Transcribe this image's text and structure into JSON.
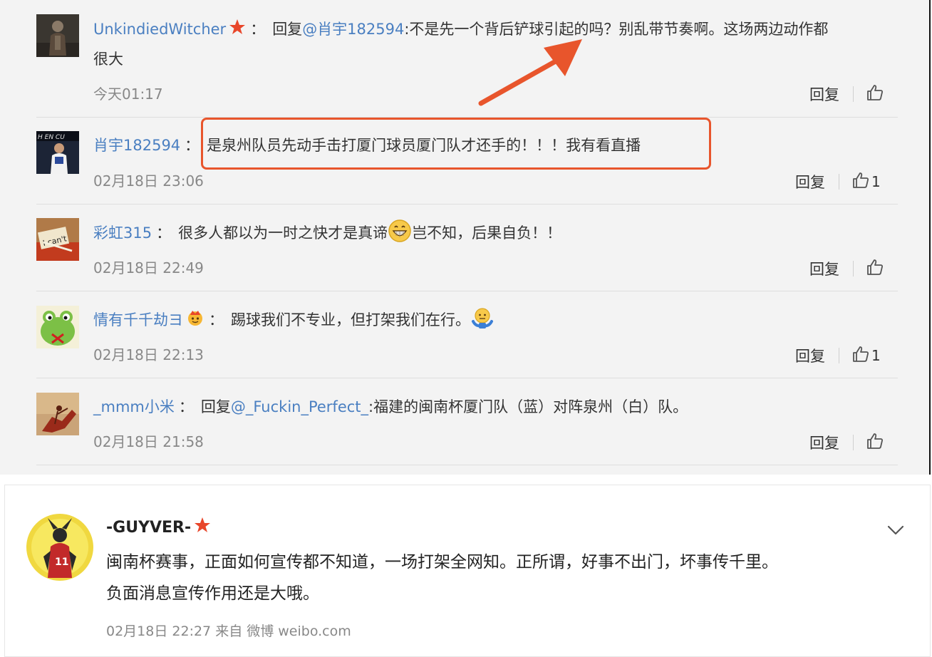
{
  "colors": {
    "link": "#4a7fc1",
    "highlight": "#e8552c",
    "star": "#e8462a",
    "text": "#333333",
    "muted": "#888888"
  },
  "comments": [
    {
      "user": "UnkindiedWitcher",
      "has_star": true,
      "prefix": "回复",
      "mention": "@肖宇182594",
      "text": ":不是先一个背后铲球引起的吗？别乱带节奏啊。这场两边动作都",
      "text2": "很大",
      "time": "今天01:17",
      "reply_label": "回复",
      "likes": ""
    },
    {
      "user": "肖宇182594",
      "text": "是泉州队员先动手击打厦门球员厦门队才还手的！！！我有看直播",
      "time": "02月18日 23:06",
      "reply_label": "回复",
      "likes": "1"
    },
    {
      "user": "彩虹315",
      "text": "很多人都以为一时之快才是真谛",
      "text_after_emoji": "岂不知，后果自负！！",
      "emoji": "grin-emoji",
      "time": "02月18日 22:49",
      "reply_label": "回复",
      "likes": ""
    },
    {
      "user": "情有千千劫ヨ",
      "has_crown": true,
      "text": "踢球我们不专业，但打架我们在行。",
      "emoji": "shrug-emoji",
      "time": "02月18日 22:13",
      "reply_label": "回复",
      "likes": "1"
    },
    {
      "user": "_mmm小米",
      "prefix": "回复",
      "mention": "@_Fuckin_Perfect_",
      "text": ":福建的闽南杯厦门队（蓝）对阵泉州（白）队。",
      "time": "02月18日 21:58",
      "reply_label": "回复",
      "likes": ""
    }
  ],
  "post": {
    "user": "-GUYVER-",
    "line1": "闽南杯赛事，正面如何宣传都不知道，一场打架全网知。正所谓，好事不出门，坏事传千里。",
    "line2": "负面消息宣传作用还是大哦。",
    "meta": "02月18日 22:27 来自 微博 weibo.com"
  }
}
